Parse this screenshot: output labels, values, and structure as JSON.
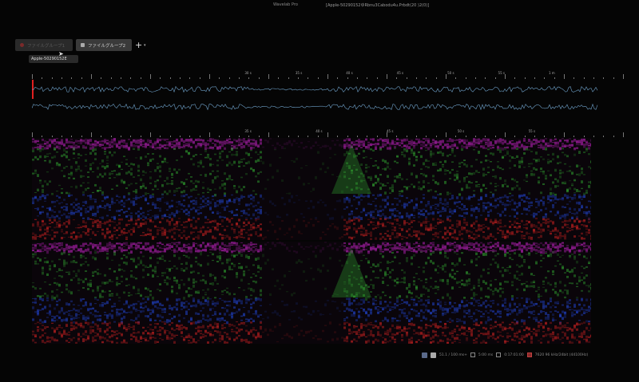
{
  "window": {
    "app_title": "Wavelab Pro",
    "document_title": "[Apple-50290152ゆRbnu3Cabodu4u.Prbdt(20 )2(0)]"
  },
  "tabs": [
    {
      "label": "ファイルグループ1",
      "active": false
    },
    {
      "label": "ファイルグループ2",
      "active": true
    }
  ],
  "add_tab": {
    "plus": "+",
    "caret": "▾"
  },
  "file": {
    "name": "Apple-50290152E"
  },
  "waveform_ruler": {
    "labels": [
      "30 s",
      "35 s",
      "40 s",
      "45 s",
      "50 s",
      "55 s",
      "1 m"
    ]
  },
  "spectrum_ruler": {
    "labels": [
      "35 s",
      "40 s",
      "45 s",
      "50 s",
      "55 s"
    ]
  },
  "status": {
    "zoom": "51.1 / 100 ms+",
    "position": "5:00 ms",
    "selection": "0:17:01:00",
    "format": "7620 96 kHz/24bit (44100Hz)"
  },
  "colors": {
    "background": "#050505",
    "playhead": "#e02020",
    "waveform": "#6ea0c8",
    "spectrum_top": "#8a1a8a",
    "spectrum_mid": "#30a030",
    "spectrum_low": "#2040c0",
    "spectrum_bottom": "#c02020"
  }
}
